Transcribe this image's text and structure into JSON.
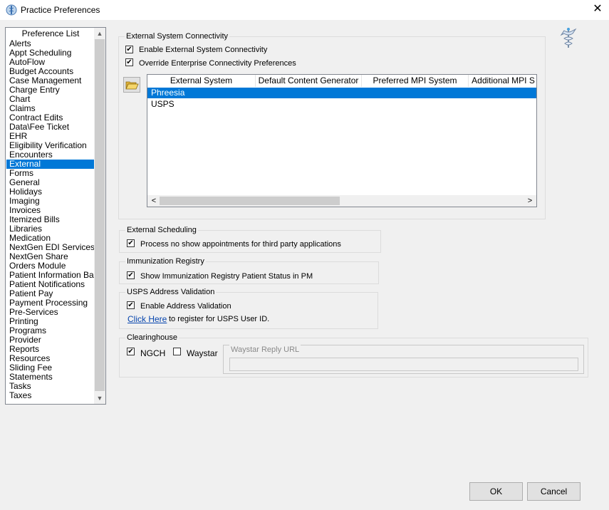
{
  "window": {
    "title": "Practice Preferences",
    "close": "✕"
  },
  "preference_list": {
    "header": "Preference List",
    "items": [
      "Alerts",
      "Appt Scheduling",
      "AutoFlow",
      "Budget Accounts",
      "Case Management",
      "Charge Entry",
      "Chart",
      "Claims",
      "Contract Edits",
      "Data\\Fee Ticket",
      "EHR",
      "Eligibility Verification",
      "Encounters",
      "External",
      "Forms",
      "General",
      "Holidays",
      "Imaging",
      "Invoices",
      "Itemized Bills",
      "Libraries",
      "Medication",
      "NextGen EDI Services",
      "NextGen Share",
      "Orders Module",
      "Patient Information Bar",
      "Patient Notifications",
      "Patient Pay",
      "Payment Processing",
      "Pre-Services",
      "Printing",
      "Programs",
      "Provider",
      "Reports",
      "Resources",
      "Sliding Fee",
      "Statements",
      "Tasks",
      "Taxes"
    ],
    "selected": "External"
  },
  "external_connectivity": {
    "title": "External System Connectivity",
    "enable_label": "Enable External System Connectivity",
    "enable_checked": true,
    "override_label": "Override Enterprise Connectivity Preferences",
    "override_checked": true,
    "columns": [
      "External System",
      "Default Content Generator",
      "Preferred MPI System",
      "Additional MPI S"
    ],
    "rows": [
      {
        "name": "Phreesia",
        "selected": true
      },
      {
        "name": "USPS",
        "selected": false
      }
    ]
  },
  "external_scheduling": {
    "title": "External Scheduling",
    "label": "Process no show appointments for third party applications",
    "checked": true
  },
  "immunization_registry": {
    "title": "Immunization Registry",
    "label": "Show Immunization Registry Patient Status in PM",
    "checked": true
  },
  "usps": {
    "title": "USPS Address Validation",
    "label": "Enable Address Validation",
    "checked": true,
    "link": "Click Here",
    "link_suffix": "to register for USPS User ID."
  },
  "clearinghouse": {
    "title": "Clearinghouse",
    "ngch_label": "NGCH",
    "ngch_checked": true,
    "waystar_label": "Waystar",
    "waystar_checked": false,
    "reply_url_label": "Waystar Reply URL",
    "reply_url_value": ""
  },
  "buttons": {
    "ok": "OK",
    "cancel": "Cancel"
  },
  "icons": {
    "check": "✔",
    "scroll_up": "▲",
    "scroll_down": "▼",
    "scroll_left": "<",
    "scroll_right": ">"
  }
}
